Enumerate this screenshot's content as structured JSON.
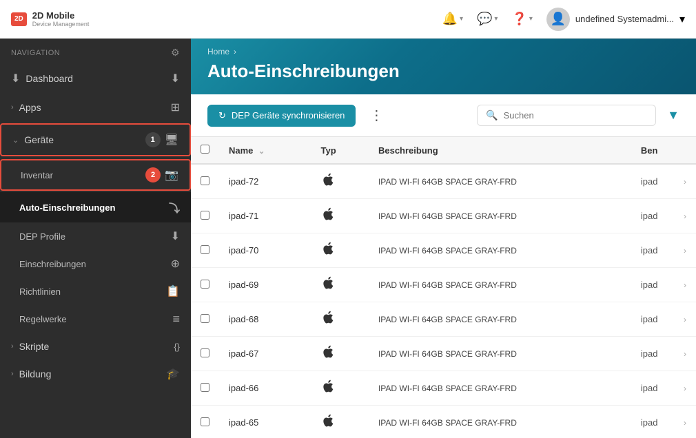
{
  "header": {
    "logo_line1": "2D Mobile",
    "logo_line2": "Device Management",
    "icons": [
      {
        "name": "bell",
        "symbol": "🔔",
        "caret": true
      },
      {
        "name": "chat",
        "symbol": "💬",
        "caret": true
      },
      {
        "name": "help",
        "symbol": "❓",
        "caret": true
      }
    ],
    "user_name": "undefined Systemadmi...",
    "user_caret": true
  },
  "sidebar": {
    "nav_label": "NAVIGATION",
    "items": [
      {
        "id": "dashboard",
        "label": "Dashboard",
        "icon": "⬇",
        "level": 0,
        "active": false
      },
      {
        "id": "apps",
        "label": "Apps",
        "icon": "⊞",
        "level": 0,
        "has_chevron": true,
        "active": false
      },
      {
        "id": "geraete",
        "label": "Geräte",
        "icon": "🖥",
        "level": 0,
        "has_chevron": true,
        "active": true,
        "badge": "1",
        "badge_red": false,
        "has_border": true
      },
      {
        "id": "inventar",
        "label": "Inventar",
        "icon": "📷",
        "level": 1,
        "active": false,
        "badge": "2",
        "badge_red": true
      },
      {
        "id": "auto-einschreibungen",
        "label": "Auto-Einschreibungen",
        "icon": "⤵",
        "level": 1,
        "active": true
      },
      {
        "id": "dep-profile",
        "label": "DEP Profile",
        "icon": "⬇",
        "level": 1,
        "active": false
      },
      {
        "id": "einschreibungen",
        "label": "Einschreibungen",
        "icon": "⊕",
        "level": 1,
        "active": false
      },
      {
        "id": "richtlinien",
        "label": "Richtlinien",
        "icon": "📋",
        "level": 1,
        "active": false
      },
      {
        "id": "regelwerke",
        "label": "Regelwerke",
        "icon": "≡",
        "level": 1,
        "active": false
      },
      {
        "id": "skripte",
        "label": "Skripte",
        "icon": "{}",
        "level": 0,
        "has_chevron": true,
        "active": false
      },
      {
        "id": "bildung",
        "label": "Bildung",
        "icon": "🎓",
        "level": 0,
        "has_chevron": true,
        "active": false
      }
    ]
  },
  "page": {
    "breadcrumb_home": "Home",
    "breadcrumb_arrow": "›",
    "title": "Auto-Einschreibungen"
  },
  "toolbar": {
    "sync_button_label": "DEP Geräte synchronisieren",
    "sync_icon": "↻",
    "search_placeholder": "Suchen"
  },
  "table": {
    "columns": [
      {
        "id": "checkbox",
        "label": ""
      },
      {
        "id": "name",
        "label": "Name",
        "sortable": true
      },
      {
        "id": "typ",
        "label": "Typ"
      },
      {
        "id": "beschreibung",
        "label": "Beschreibung"
      },
      {
        "id": "ben",
        "label": "Ben"
      }
    ],
    "rows": [
      {
        "name": "ipad-72",
        "typ": "🍎",
        "beschreibung": "IPAD WI-FI 64GB SPACE GRAY-FRD",
        "ben": "ipad"
      },
      {
        "name": "ipad-71",
        "typ": "🍎",
        "beschreibung": "IPAD WI-FI 64GB SPACE GRAY-FRD",
        "ben": "ipad"
      },
      {
        "name": "ipad-70",
        "typ": "🍎",
        "beschreibung": "IPAD WI-FI 64GB SPACE GRAY-FRD",
        "ben": "ipad"
      },
      {
        "name": "ipad-69",
        "typ": "🍎",
        "beschreibung": "IPAD WI-FI 64GB SPACE GRAY-FRD",
        "ben": "ipad"
      },
      {
        "name": "ipad-68",
        "typ": "🍎",
        "beschreibung": "IPAD WI-FI 64GB SPACE GRAY-FRD",
        "ben": "ipad"
      },
      {
        "name": "ipad-67",
        "typ": "🍎",
        "beschreibung": "IPAD WI-FI 64GB SPACE GRAY-FRD",
        "ben": "ipad"
      },
      {
        "name": "ipad-66",
        "typ": "🍎",
        "beschreibung": "IPAD WI-FI 64GB SPACE GRAY-FRD",
        "ben": "ipad"
      },
      {
        "name": "ipad-65",
        "typ": "🍎",
        "beschreibung": "IPAD WI-FI 64GB SPACE GRAY-FRD",
        "ben": "ipad"
      }
    ]
  }
}
